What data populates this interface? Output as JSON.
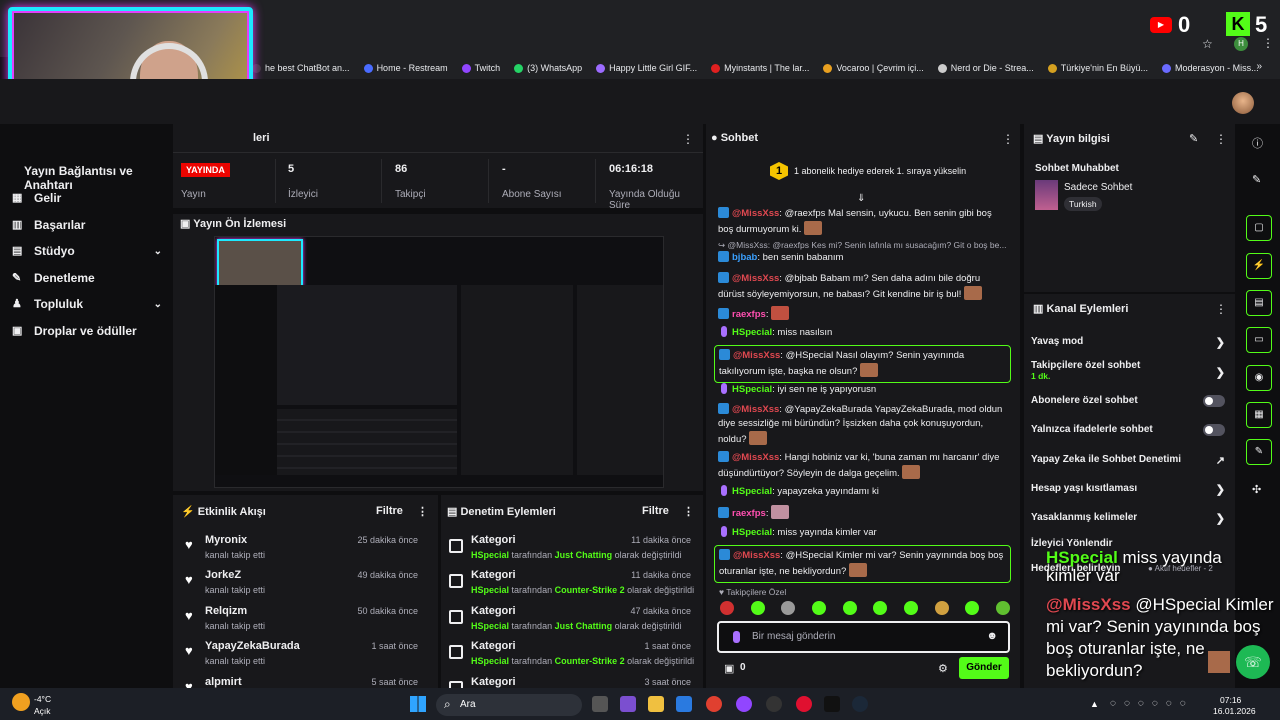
{
  "browser": {
    "bookmarks": [
      {
        "label": "he best ChatBot an...",
        "color": "#3a3a3a"
      },
      {
        "label": "Home - Restream",
        "color": "#4a6cff"
      },
      {
        "label": "Twitch",
        "color": "#9146ff"
      },
      {
        "label": "(3) WhatsApp",
        "color": "#25d366"
      },
      {
        "label": "Happy Little Girl GIF...",
        "color": "#9c6bff"
      },
      {
        "label": "Myinstants | The lar...",
        "color": "#e02020"
      },
      {
        "label": "Vocaroo | Çevrim içi...",
        "color": "#e8a020"
      },
      {
        "label": "Nerd or Die - Strea...",
        "color": "#cccccc"
      },
      {
        "label": "Türkiye'nin En Büyü...",
        "color": "#d4a020"
      },
      {
        "label": "Moderasyon - Miss...",
        "color": "#6a6aff"
      }
    ],
    "more": "»",
    "profile_letter": "H"
  },
  "overlay_widgets": {
    "youtube_icon": "▶",
    "youtube_count": "0",
    "kick_icon": "K",
    "kick_count": "5"
  },
  "sidebar": {
    "heading": "Yayın Bağlantısı ve Anahtarı",
    "items": [
      {
        "label": "Gelir",
        "icon": "money-icon"
      },
      {
        "label": "Başarılar",
        "icon": "trophy-icon"
      },
      {
        "label": "Stüdyo",
        "icon": "studio-icon"
      },
      {
        "label": "Denetleme",
        "icon": "wrench-icon"
      },
      {
        "label": "Topluluk",
        "icon": "community-icon"
      },
      {
        "label": "Droplar ve ödüller",
        "icon": "gift-icon"
      }
    ]
  },
  "stats": {
    "title_fragment": "leri",
    "live_badge": "YAYINDA",
    "items": [
      {
        "value": "",
        "label": "Yayın"
      },
      {
        "value": "5",
        "label": "İzleyici"
      },
      {
        "value": "86",
        "label": "Takipçi"
      },
      {
        "value": "-",
        "label": "Abone Sayısı"
      },
      {
        "value": "06:16:18",
        "label": "Yayında Olduğu Süre"
      }
    ]
  },
  "preview": {
    "title": "Yayın Ön İzlemesi"
  },
  "activity": {
    "title": "Etkinlik Akışı",
    "filter": "Filtre",
    "rows": [
      {
        "name": "Myronix",
        "sub": "kanalı takip etti",
        "time": "25 dakika önce"
      },
      {
        "name": "JorkeZ",
        "sub": "kanalı takip etti",
        "time": "49 dakika önce"
      },
      {
        "name": "Relqizm",
        "sub": "kanalı takip etti",
        "time": "50 dakika önce"
      },
      {
        "name": "YapayZekaBurada",
        "sub": "kanalı takip etti",
        "time": "1 saat önce"
      },
      {
        "name": "alpmirt",
        "sub": "",
        "time": "5 saat önce"
      }
    ]
  },
  "mod_actions": {
    "title": "Denetim Eylemleri",
    "filter": "Filtre",
    "by": "tarafından",
    "changed": "olarak değiştirildi",
    "rows": [
      {
        "name": "Kategori",
        "user": "HSpecial",
        "value": "Just Chatting",
        "time": "11 dakika önce"
      },
      {
        "name": "Kategori",
        "user": "HSpecial",
        "value": "Counter-Strike 2",
        "time": "11 dakika önce"
      },
      {
        "name": "Kategori",
        "user": "HSpecial",
        "value": "Just Chatting",
        "time": "47 dakika önce"
      },
      {
        "name": "Kategori",
        "user": "HSpecial",
        "value": "Counter-Strike 2",
        "time": "1 saat önce"
      },
      {
        "name": "Kategori",
        "user": "",
        "value": "",
        "time": "3 saat önce"
      }
    ]
  },
  "chat": {
    "title": "Sohbet",
    "banner_rank": "1",
    "banner": "1 abonelik hediye ederek 1. sıraya yükselin",
    "messages": [
      {
        "user": "@MissXss",
        "text": ": @raexfps Mal sensin, uykucu. Ben senin gibi boş boş durmuyorum ki."
      },
      {
        "reply": "↪ @MissXss: @raexfps Kes mi? Senin lafınla mı susacağım? Git o boş be..."
      },
      {
        "user": "bjbab",
        "text": ": ben senin babanım"
      },
      {
        "user": "@MissXss",
        "text": ": @bjbab Babam mı? Sen daha adını bile doğru dürüst söyleyemiyorsun, ne babası? Git kendine bir iş bul!"
      },
      {
        "user": "raexfps",
        "text": ":"
      },
      {
        "user": "HSpecial",
        "text": ": miss nasılsın"
      },
      {
        "user": "@MissXss",
        "text": ": @HSpecial Nasıl olayım? Senin yayınında takılıyorum işte, başka ne olsun?"
      },
      {
        "user": "HSpecial",
        "text": ": iyi sen ne iş yapıyorusn"
      },
      {
        "user": "@MissXss",
        "text": ": @YapayZekaBurada YapayZekaBurada, mod oldun diye sessizliğe mi büründün? İşsizken daha çok konuşuyordun, noldu?"
      },
      {
        "user": "@MissXss",
        "text": ": Hangi hobiniz var ki, 'buna zaman mı harcanır' diye düşündürtüyor? Söyleyin de dalga geçelim."
      },
      {
        "user": "HSpecial",
        "text": ": yapayzeka yayındamı ki"
      },
      {
        "user": "raexfps",
        "text": ":"
      },
      {
        "user": "HSpecial",
        "text": ": miss yayında kimler var"
      },
      {
        "user": "@MissXss",
        "text": ": @HSpecial Kimler mi var? Senin yayınında boş boş oturanlar işte, ne bekliyordun?"
      }
    ],
    "followers_only": "♥ Takipçilere Özel",
    "input_placeholder": "Bir mesaj gönderin",
    "points": "0",
    "send": "Gönder"
  },
  "stream_info": {
    "title": "Yayın bilgisi",
    "stream_title": "Sohbet Muhabbet",
    "category": "Sadece Sohbet",
    "language": "Turkish"
  },
  "channel_actions": {
    "title": "Kanal Eylemleri",
    "items": [
      {
        "label": "Yavaş mod",
        "sub": ""
      },
      {
        "label": "Takipçilere özel sohbet",
        "sub": "1 dk."
      },
      {
        "label": "Abonelere özel sohbet",
        "sub": ""
      },
      {
        "label": "Yalnızca ifadelerle sohbet",
        "sub": ""
      },
      {
        "label": "Yapay Zeka ile Sohbet Denetimi",
        "sub": ""
      },
      {
        "label": "Hesap yaşı kısıtlaması",
        "sub": ""
      },
      {
        "label": "Yasaklanmış kelimeler",
        "sub": ""
      }
    ],
    "hidden_1": "İzleyici Yönlendir",
    "hidden_2": "Hedefleri belirleyin",
    "hidden_3": "● Aktif hedefler - 2"
  },
  "overlay_chat": {
    "user1": "HSpecial",
    "text1": "miss yayında",
    "text1b": "kimler var",
    "user2": "@MissXss",
    "text2": "@HSpecial Kimler mi var? Senin yayınında boş boş oturanlar işte, ne bekliyordun?"
  },
  "taskbar": {
    "temp": "-4°C",
    "weather": "Açık",
    "search": "Ara",
    "time": "07:16",
    "date": "16.01.2026"
  }
}
